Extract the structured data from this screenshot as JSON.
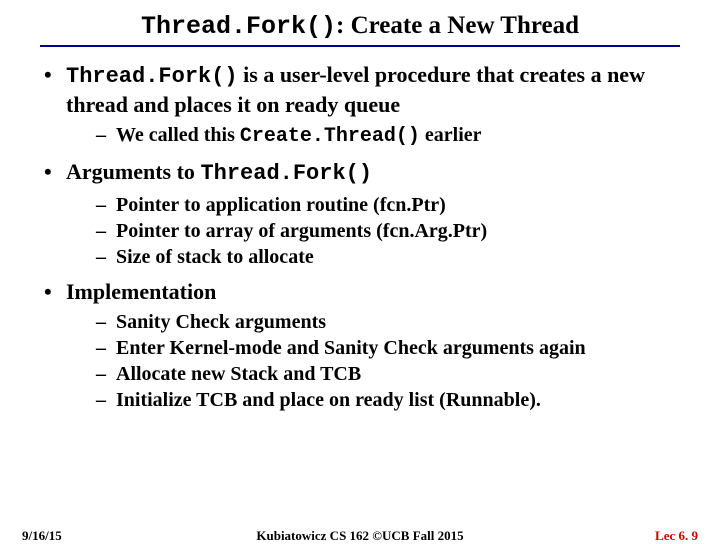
{
  "title": {
    "code": "Thread.Fork()",
    "rest": ": Create a New Thread"
  },
  "bullets": [
    {
      "parts": [
        {
          "type": "code",
          "text": "Thread.Fork()"
        },
        {
          "type": "text",
          "text": " is a user-level procedure that creates a new thread and places it on ready queue"
        }
      ],
      "sub": [
        {
          "parts": [
            {
              "type": "text",
              "text": "We called this "
            },
            {
              "type": "code",
              "text": "Create.Thread()"
            },
            {
              "type": "text",
              "text": " earlier"
            }
          ]
        }
      ]
    },
    {
      "parts": [
        {
          "type": "text",
          "text": "Arguments to "
        },
        {
          "type": "code",
          "text": "Thread.Fork()"
        }
      ],
      "sub": [
        {
          "parts": [
            {
              "type": "text",
              "text": "Pointer to application routine (fcn.Ptr)"
            }
          ]
        },
        {
          "parts": [
            {
              "type": "text",
              "text": "Pointer to array of arguments (fcn.Arg.Ptr)"
            }
          ]
        },
        {
          "parts": [
            {
              "type": "text",
              "text": "Size of stack to allocate"
            }
          ]
        }
      ]
    },
    {
      "parts": [
        {
          "type": "text",
          "text": "Implementation"
        }
      ],
      "sub": [
        {
          "parts": [
            {
              "type": "text",
              "text": "Sanity Check arguments"
            }
          ]
        },
        {
          "parts": [
            {
              "type": "text",
              "text": "Enter Kernel-mode and Sanity Check arguments again"
            }
          ]
        },
        {
          "parts": [
            {
              "type": "text",
              "text": "Allocate new Stack and TCB"
            }
          ]
        },
        {
          "parts": [
            {
              "type": "text",
              "text": "Initialize TCB and place on ready list (Runnable)."
            }
          ]
        }
      ]
    }
  ],
  "footer": {
    "date": "9/16/15",
    "center": "Kubiatowicz CS 162 ©UCB Fall 2015",
    "lec": "Lec 6. 9"
  }
}
